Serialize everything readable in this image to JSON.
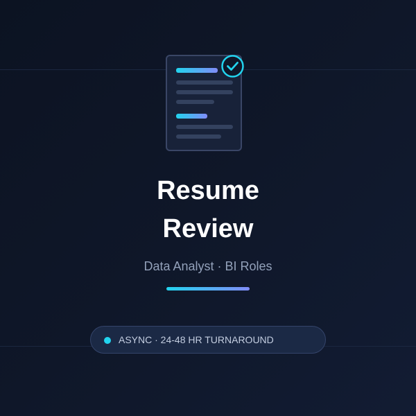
{
  "card": {
    "title_line1": "Resume",
    "title_line2": "Review",
    "subtitle": "Data Analyst · BI Roles",
    "status_text": "ASYNC · 24-48 HR TURNAROUND"
  },
  "icons": {
    "document": "document-icon",
    "check": "check-circle-icon",
    "status_dot": "status-dot-icon"
  },
  "colors": {
    "background": "#0f1729",
    "accent_start": "#22d3ee",
    "accent_end": "#818cf8",
    "title": "#ffffff",
    "subtitle": "#93a1ba",
    "pill_background": "#1b2945"
  }
}
